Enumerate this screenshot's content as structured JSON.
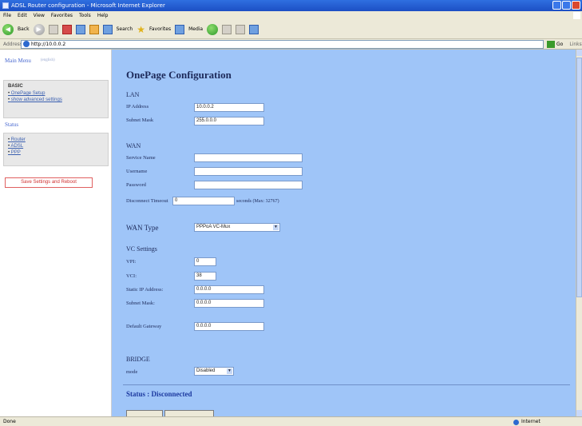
{
  "window": {
    "title": "ADSL Router configuration - Microsoft Internet Explorer"
  },
  "menubar": {
    "items": [
      "File",
      "Edit",
      "View",
      "Favorites",
      "Tools",
      "Help"
    ]
  },
  "toolbar": {
    "back_label": "Back",
    "search_label": "Search",
    "favorites_label": "Favorites",
    "media_label": "Media"
  },
  "addressbar": {
    "label": "Address",
    "url": "http://10.0.0.2",
    "go_label": "Go",
    "links_label": "Links"
  },
  "leftnav": {
    "main_menu": "Main Menu",
    "main_menu_sub": "(english)",
    "basic_title": "BASIC",
    "basic_links": [
      "OnePage Setup",
      "show advanced settings"
    ],
    "status_title": "Status",
    "status_links": [
      "Router",
      "ADSL",
      "PPP"
    ],
    "save_button": "Save Settings and Reboot"
  },
  "main": {
    "page_title": "OnePage Configuration",
    "lan": {
      "heading": "LAN",
      "ip_label": "IP Address",
      "ip_value": "10.0.0.2",
      "mask_label": "Subnet Mask",
      "mask_value": "255.0.0.0"
    },
    "wan": {
      "heading": "WAN",
      "service_label": "Service Name",
      "service_value": "",
      "username_label": "Username",
      "username_value": "",
      "password_label": "Password",
      "password_value": "",
      "timeout_label": "Disconnect Timeout",
      "timeout_value": "0",
      "timeout_note": "seconds (Max: 32767)",
      "type_label": "WAN Type",
      "type_value": "PPPoA VC-Mux"
    },
    "vc": {
      "heading": "VC Settings",
      "vpi_label": "VPI:",
      "vpi_value": "0",
      "vci_label": "VCI:",
      "vci_value": "38",
      "static_ip_label": "Static IP Address:",
      "static_ip_value": "0.0.0.0",
      "subnet_label": "Subnet Mask:",
      "subnet_value": "0.0.0.0",
      "gateway_label": "Default Gateway",
      "gateway_value": "0.0.0.0"
    },
    "bridge": {
      "heading": "BRIDGE",
      "mode_label": "mode",
      "mode_value": "Disabled"
    },
    "status": "Status : Disconnected"
  },
  "statusbar": {
    "left": "Done",
    "zone": "Internet"
  }
}
